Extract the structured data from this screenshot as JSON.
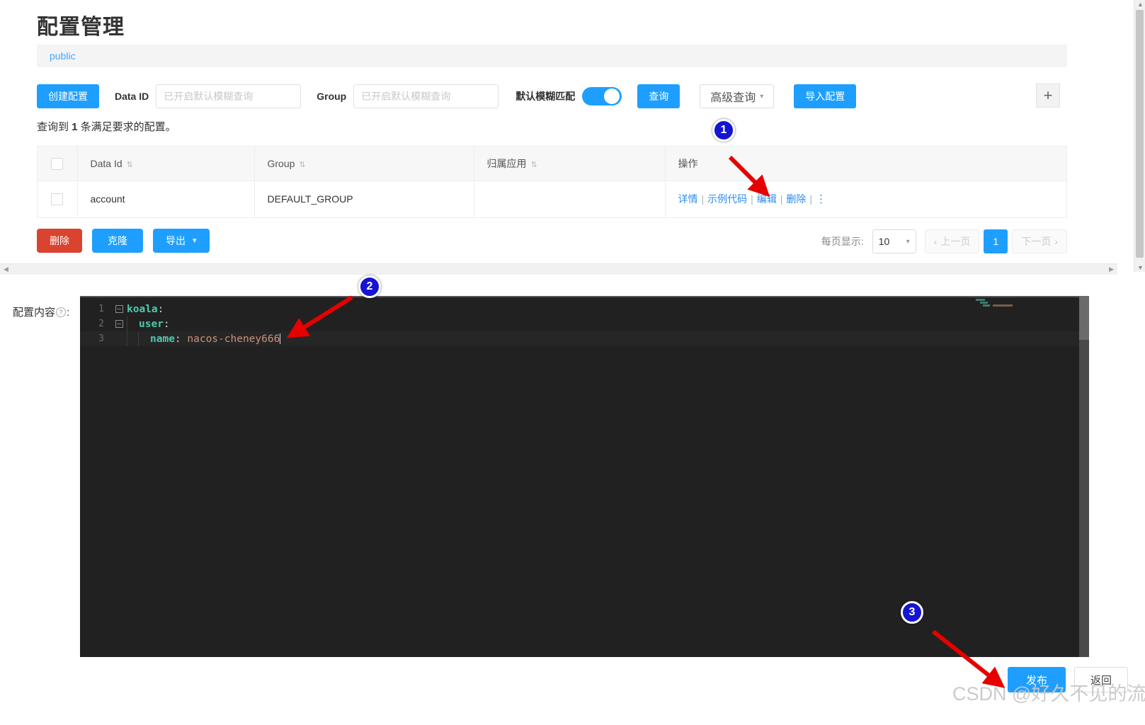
{
  "page": {
    "title": "配置管理",
    "namespace": "public"
  },
  "toolbar": {
    "create_label": "创建配置",
    "dataid_label": "Data ID",
    "dataid_value": "",
    "dataid_placeholder": "已开启默认模糊查询",
    "group_label": "Group",
    "group_value": "",
    "group_placeholder": "已开启默认模糊查询",
    "fuzzy_label": "默认模糊匹配",
    "fuzzy_on": true,
    "query_label": "查询",
    "advanced_label": "高级查询",
    "advanced_chevron": "chevron-down-icon",
    "import_label": "导入配置",
    "plus_label": "+"
  },
  "result": {
    "prefix": "查询到 ",
    "count": "1",
    "suffix": " 条满足要求的配置。"
  },
  "table": {
    "columns": [
      "Data Id",
      "Group",
      "归属应用",
      "操作"
    ],
    "sort_icon": "⇅",
    "rows": [
      {
        "data_id": "account",
        "group": "DEFAULT_GROUP",
        "app": "",
        "actions": [
          "详情",
          "示例代码",
          "编辑",
          "删除"
        ],
        "more_icon": "vertical-dots-icon"
      }
    ]
  },
  "actions": {
    "delete_label": "删除",
    "clone_label": "克隆",
    "export_label": "导出",
    "export_chevron": "chevron-down-icon"
  },
  "pagination": {
    "per_page_label": "每页显示:",
    "per_page_value": "10",
    "prev_label": "上一页",
    "next_label": "下一页",
    "current_page": "1"
  },
  "editor": {
    "label": "配置内容",
    "help_icon": "question-mark-icon",
    "label_colon": ":",
    "lines": [
      {
        "n": "1",
        "fold": "−",
        "indent": 0,
        "key": "koala",
        "value": ""
      },
      {
        "n": "2",
        "fold": "−",
        "indent": 1,
        "key": "user",
        "value": ""
      },
      {
        "n": "3",
        "fold": "",
        "indent": 2,
        "key": "name",
        "value": " nacos-cheney666"
      }
    ],
    "language_hint": "yaml",
    "colors": {
      "background": "#212121",
      "key": "#4ec9b0",
      "value": "#ce9178",
      "gutter": "#6d6d6d"
    }
  },
  "footer": {
    "publish_label": "发布",
    "return_label": "返回"
  },
  "annotations": {
    "badges": [
      "1",
      "2",
      "3"
    ],
    "color": "#1414d2",
    "arrow_color": "#e60000"
  },
  "watermark": {
    "text": "CSDN @好久不见的流星"
  }
}
